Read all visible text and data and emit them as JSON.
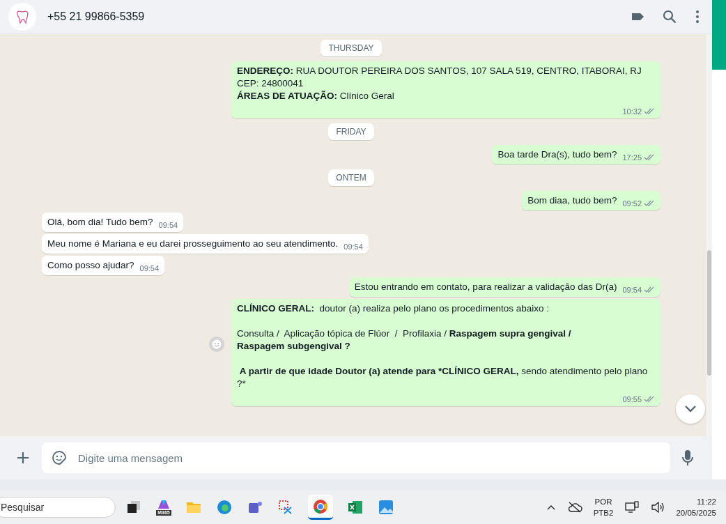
{
  "header": {
    "contact": "+55 21 99866-5359"
  },
  "messages": [
    {
      "kind": "date",
      "text": "THURSDAY"
    },
    {
      "kind": "out",
      "text": "**ENDEREÇO:** RUA DOUTOR PEREIRA DOS SANTOS, 107 SALA 519, CENTRO, ITABORAI, RJ\nCEP: 24800041\n**ÁREAS DE ATUAÇÃO:** Clínico Geral",
      "time": "10:32"
    },
    {
      "kind": "date",
      "text": "FRIDAY"
    },
    {
      "kind": "out",
      "text": "Boa tarde Dra(s), tudo bem?",
      "time": "17:25"
    },
    {
      "kind": "date",
      "text": "ONTEM"
    },
    {
      "kind": "out",
      "text": "Bom diaa, tudo bem?",
      "time": "09:52"
    },
    {
      "kind": "in",
      "text": "Olá, bom dia! Tudo bem?",
      "time": "09:54"
    },
    {
      "kind": "in",
      "text": "Meu nome é Mariana e eu darei prosseguimento ao seu atendimento.",
      "time": "09:54"
    },
    {
      "kind": "in",
      "text": "Como posso ajudar?",
      "time": "09:54"
    },
    {
      "kind": "out",
      "text": "Estou entrando em contato, para realizar a validação das Dr(a)",
      "time": "09:54"
    },
    {
      "kind": "out",
      "text": "**CLÍNICO GERAL:**  doutor (a) realiza pelo plano os procedimentos abaixo :\n\nConsulta /  Aplicação tópica de Flúor  /  Profilaxia / **Raspagem supra gengival /**\n**Raspagem subgengival ?**\n\n **A partir de que idade Doutor (a) atende para *CLÍNICO GERAL,** sendo atendimento pelo plano ?*",
      "time": "09:55",
      "react": true
    }
  ],
  "composer": {
    "placeholder": "Digite uma mensagem"
  },
  "taskbar": {
    "search": {
      "placeholder": "Pesquisar"
    },
    "m365_label": "M365",
    "language": "POR",
    "layout": "PTB2",
    "time": "11:22",
    "date": "20/05/2025"
  }
}
